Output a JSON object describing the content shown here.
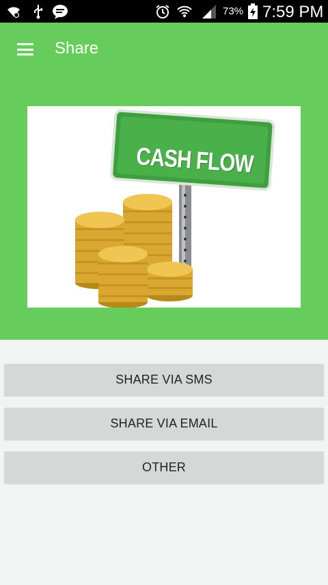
{
  "status_bar": {
    "battery_percent": "73%",
    "time": "7:59 PM",
    "icons": [
      "wifi-icon",
      "usb-icon",
      "message-icon",
      "alarm-icon",
      "wifi-signal-icon",
      "cell-signal-icon",
      "battery-charging-icon"
    ]
  },
  "app_bar": {
    "title": "Share",
    "menu_icon": "hamburger-menu-icon",
    "color": "#66cc5b"
  },
  "hero": {
    "image_sign_text": "CASH FLOW",
    "background": "#66cc5b"
  },
  "actions": {
    "sms_label": "SHARE VIA SMS",
    "email_label": "SHARE VIA EMAIL",
    "other_label": "OTHER"
  }
}
